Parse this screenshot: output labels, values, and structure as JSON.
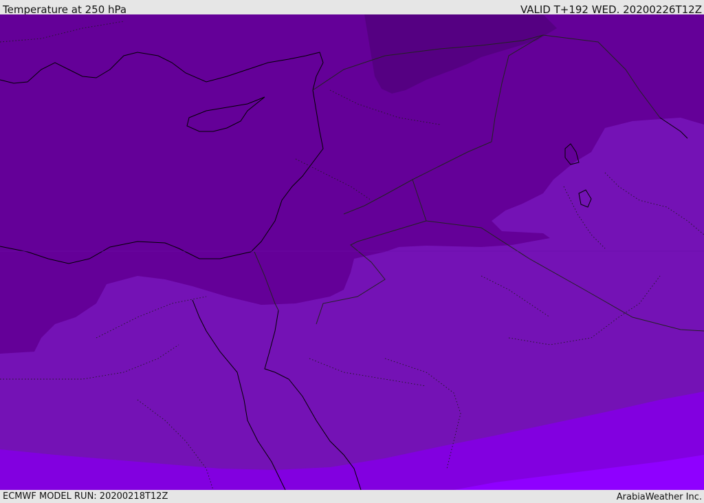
{
  "header": {
    "title": "Temperature at 250 hPa",
    "valid": "VALID T+192 WED. 20200226T12Z"
  },
  "footer": {
    "model_run": "ECMWF MODEL RUN: 20200218T12Z",
    "credit": "ArabiaWeather Inc."
  },
  "map": {
    "colors": {
      "band_darkest": "#550082",
      "band_dark": "#640098",
      "band_mid": "#7412b5",
      "band_light": "#8200e0",
      "band_lightest": "#8f00ff",
      "coastline": "#000000",
      "borders": "#222222"
    }
  }
}
